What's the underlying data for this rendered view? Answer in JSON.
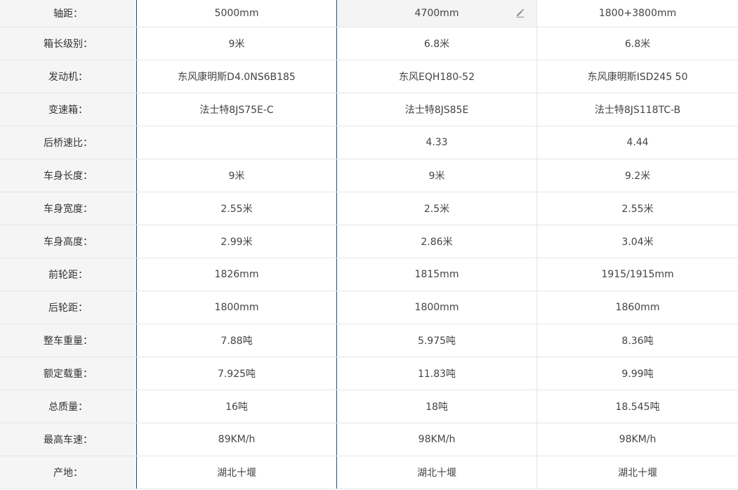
{
  "rows": [
    {
      "label": "轴距：",
      "values": [
        "5000mm",
        "4700mm",
        "1800+3800mm"
      ]
    },
    {
      "label": "箱长级别：",
      "values": [
        "9米",
        "6.8米",
        "6.8米"
      ]
    },
    {
      "label": "发动机：",
      "values": [
        "东风康明斯D4.0NS6B185",
        "东风EQH180-52",
        "东风康明斯ISD245 50"
      ]
    },
    {
      "label": "变速箱：",
      "values": [
        "法士特8JS75E-C",
        "法士特8JS85E",
        "法士特8JS118TC-B"
      ]
    },
    {
      "label": "后桥速比：",
      "values": [
        "",
        "4.33",
        "4.44"
      ]
    },
    {
      "label": "车身长度：",
      "values": [
        "9米",
        "9米",
        "9.2米"
      ]
    },
    {
      "label": "车身宽度：",
      "values": [
        "2.55米",
        "2.5米",
        "2.55米"
      ]
    },
    {
      "label": "车身高度：",
      "values": [
        "2.99米",
        "2.86米",
        "3.04米"
      ]
    },
    {
      "label": "前轮距：",
      "values": [
        "1826mm",
        "1815mm",
        "1915/1915mm"
      ]
    },
    {
      "label": "后轮距：",
      "values": [
        "1800mm",
        "1800mm",
        "1860mm"
      ]
    },
    {
      "label": "整车重量：",
      "values": [
        "7.88吨",
        "5.975吨",
        "8.36吨"
      ]
    },
    {
      "label": "额定载重：",
      "values": [
        "7.925吨",
        "11.83吨",
        "9.99吨"
      ]
    },
    {
      "label": "总质量：",
      "values": [
        "16吨",
        "18吨",
        "18.545吨"
      ]
    },
    {
      "label": "最高车速：",
      "values": [
        "89KM/h",
        "98KM/h",
        "98KM/h"
      ]
    },
    {
      "label": "产地：",
      "values": [
        "湖北十堰",
        "湖北十堰",
        "湖北十堰"
      ]
    }
  ],
  "icons": {
    "edit": "pencil-edit-icon"
  },
  "colors": {
    "label_bg": "#f5f5f5",
    "divider": "#33496b",
    "grid": "#e6e6e6",
    "highlight_bg": "#f4f4f4"
  }
}
